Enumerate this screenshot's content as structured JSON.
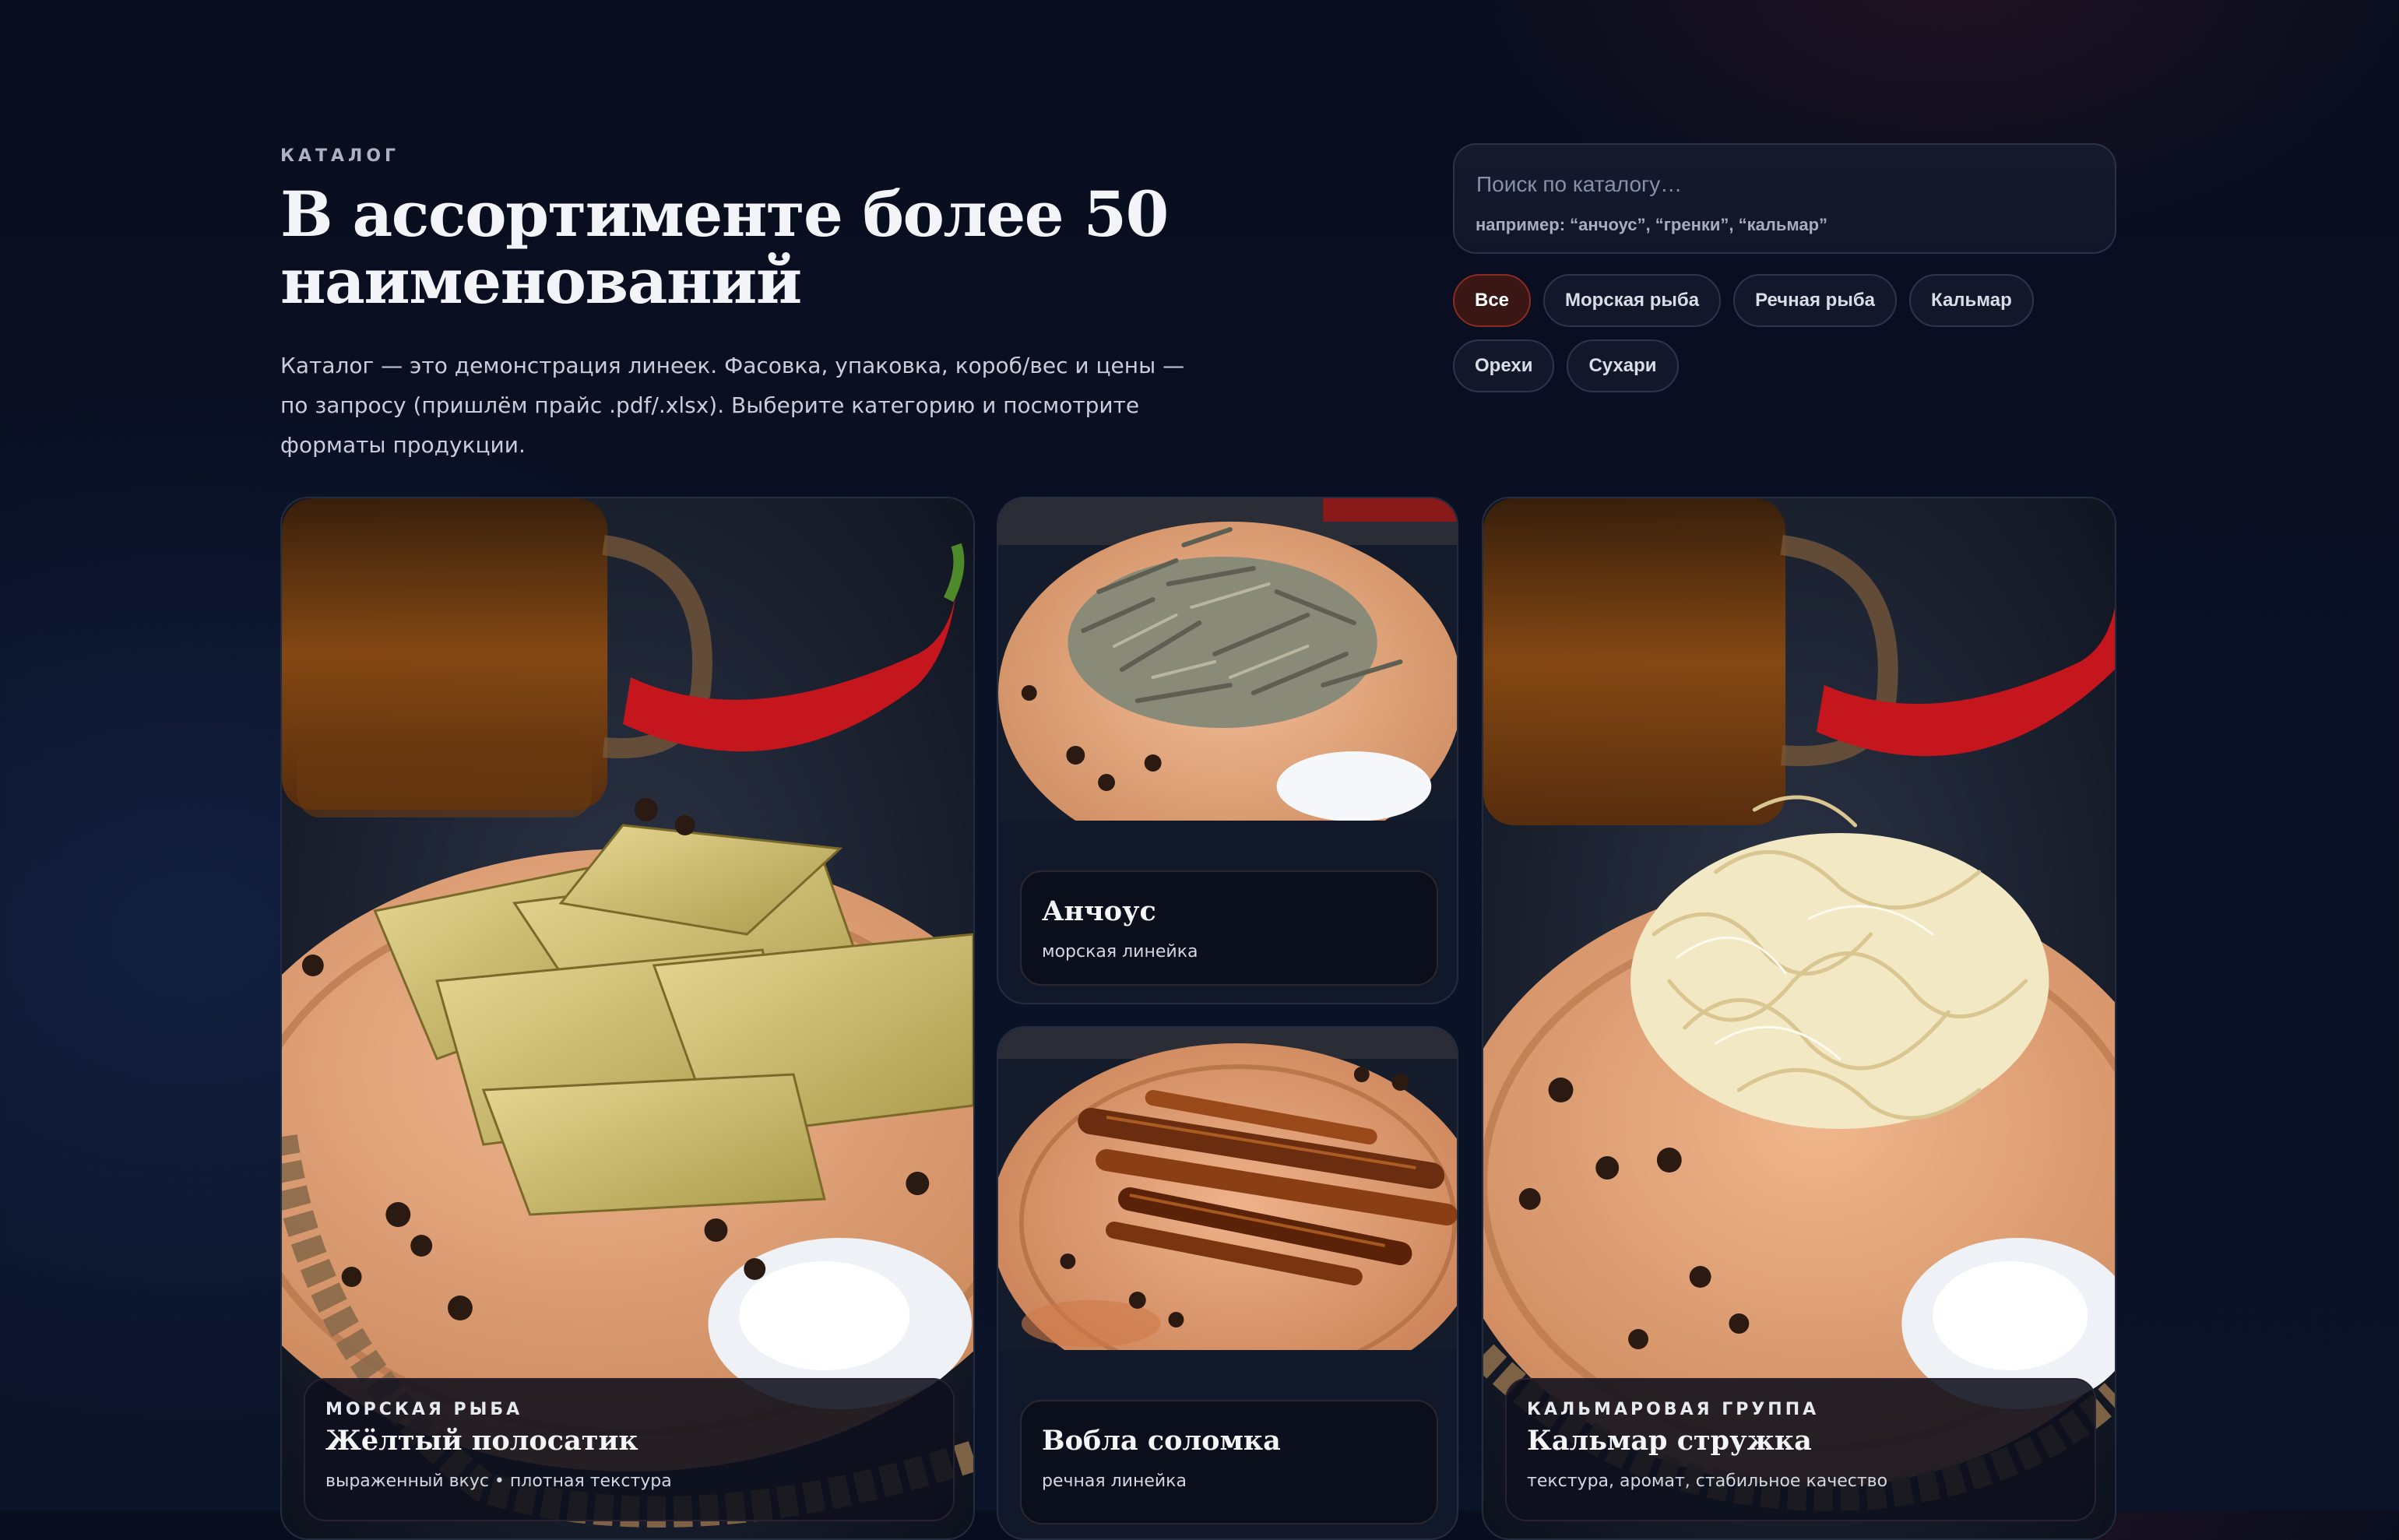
{
  "header": {
    "eyebrow": "КАТАЛОГ",
    "title": "В ассортименте более 50 наименований",
    "description": "Каталог — это демонстрация линеек. Фасовка, упаковка, короб/вес и цены — по запросу (пришлём прайс .pdf/.xlsx). Выберите категорию и посмотрите форматы продукции."
  },
  "search": {
    "placeholder": "Поиск по каталогу…",
    "hint": "например: “анчоус”, “гренки”, “кальмар”"
  },
  "filters": [
    {
      "label": "Все",
      "active": true
    },
    {
      "label": "Морская рыба",
      "active": false
    },
    {
      "label": "Речная рыба",
      "active": false
    },
    {
      "label": "Кальмар",
      "active": false
    },
    {
      "label": "Орехи",
      "active": false
    },
    {
      "label": "Сухари",
      "active": false
    }
  ],
  "products": [
    {
      "category": "МОРСКАЯ РЫБА",
      "title": "Жёлтый полосатик",
      "subtitle": "выраженный вкус • плотная текстура"
    },
    {
      "title": "Анчоус",
      "subtitle": "морская линейка"
    },
    {
      "title": "Вобла соломка",
      "subtitle": "речная линейка"
    },
    {
      "category": "КАЛЬМАРОВАЯ ГРУППА",
      "title": "Кальмар стружка",
      "subtitle": "текстура, аромат, стабильное качество"
    }
  ],
  "colors": {
    "background": "#0a1124",
    "accent": "#8c2b22",
    "accent_bg": "#3a1614",
    "card_border": "#242c40"
  }
}
